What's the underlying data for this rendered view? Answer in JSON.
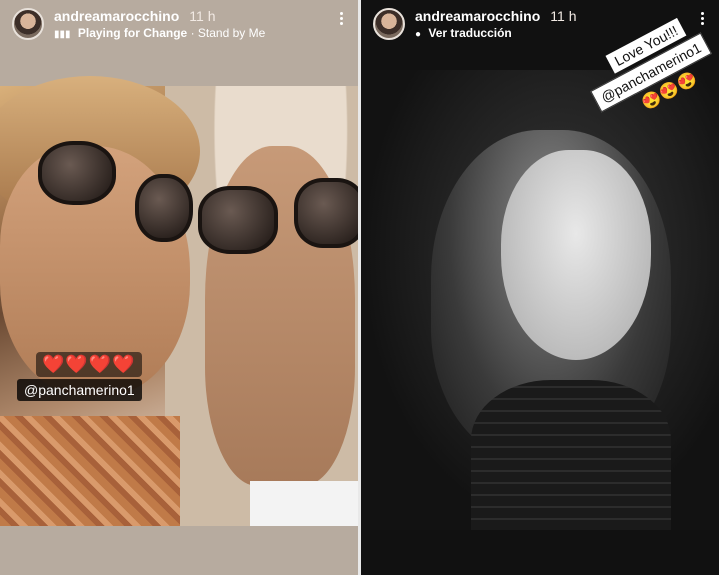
{
  "stories": [
    {
      "username": "andreamarocchino",
      "time": "11 h",
      "subtitle_icon": "music-bars-icon",
      "song": "Playing for Change",
      "separator": "·",
      "track": "Stand by Me",
      "hearts": "❤️❤️❤️❤️",
      "mention": "@panchamerino1"
    },
    {
      "username": "andreamarocchino",
      "time": "11 h",
      "subtitle_icon": "translate-bubble-icon",
      "translate_label": "Ver traducción",
      "caption": "Love You!!!",
      "mention": "@panchamerino1",
      "emojis": "😍😍😍"
    }
  ]
}
